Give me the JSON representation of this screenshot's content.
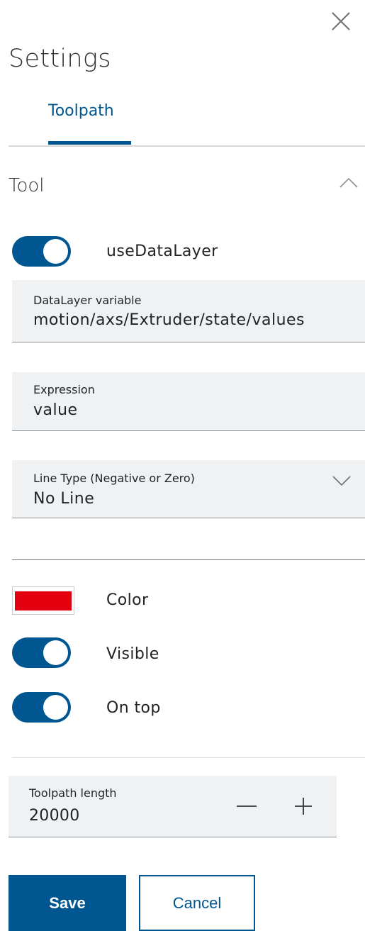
{
  "header": {
    "title": "Settings",
    "close_icon": "close-icon"
  },
  "tabs": [
    {
      "label": "Toolpath",
      "active": true
    }
  ],
  "section": {
    "title": "Tool",
    "expanded": true,
    "toggle_icon": "chevron-up-icon"
  },
  "use_data_layer": {
    "label": "useDataLayer",
    "on": true
  },
  "data_layer_variable": {
    "label": "DataLayer variable",
    "value": "motion/axs/Extruder/state/values"
  },
  "expression": {
    "label": "Expression",
    "value": "value"
  },
  "line_type": {
    "label": "Line Type (Negative or Zero)",
    "value": "No Line",
    "icon": "chevron-down-icon"
  },
  "color": {
    "label": "Color",
    "value": "#e3000f"
  },
  "visible": {
    "label": "Visible",
    "on": true
  },
  "on_top": {
    "label": "On top",
    "on": true
  },
  "toolpath_length": {
    "label": "Toolpath length",
    "value": "20000",
    "decrement_icon": "minus-icon",
    "increment_icon": "plus-icon"
  },
  "actions": {
    "save_label": "Save",
    "cancel_label": "Cancel"
  },
  "colors": {
    "primary": "#005691",
    "field_bg": "#eff1f2",
    "divider": "#d7dadc"
  }
}
